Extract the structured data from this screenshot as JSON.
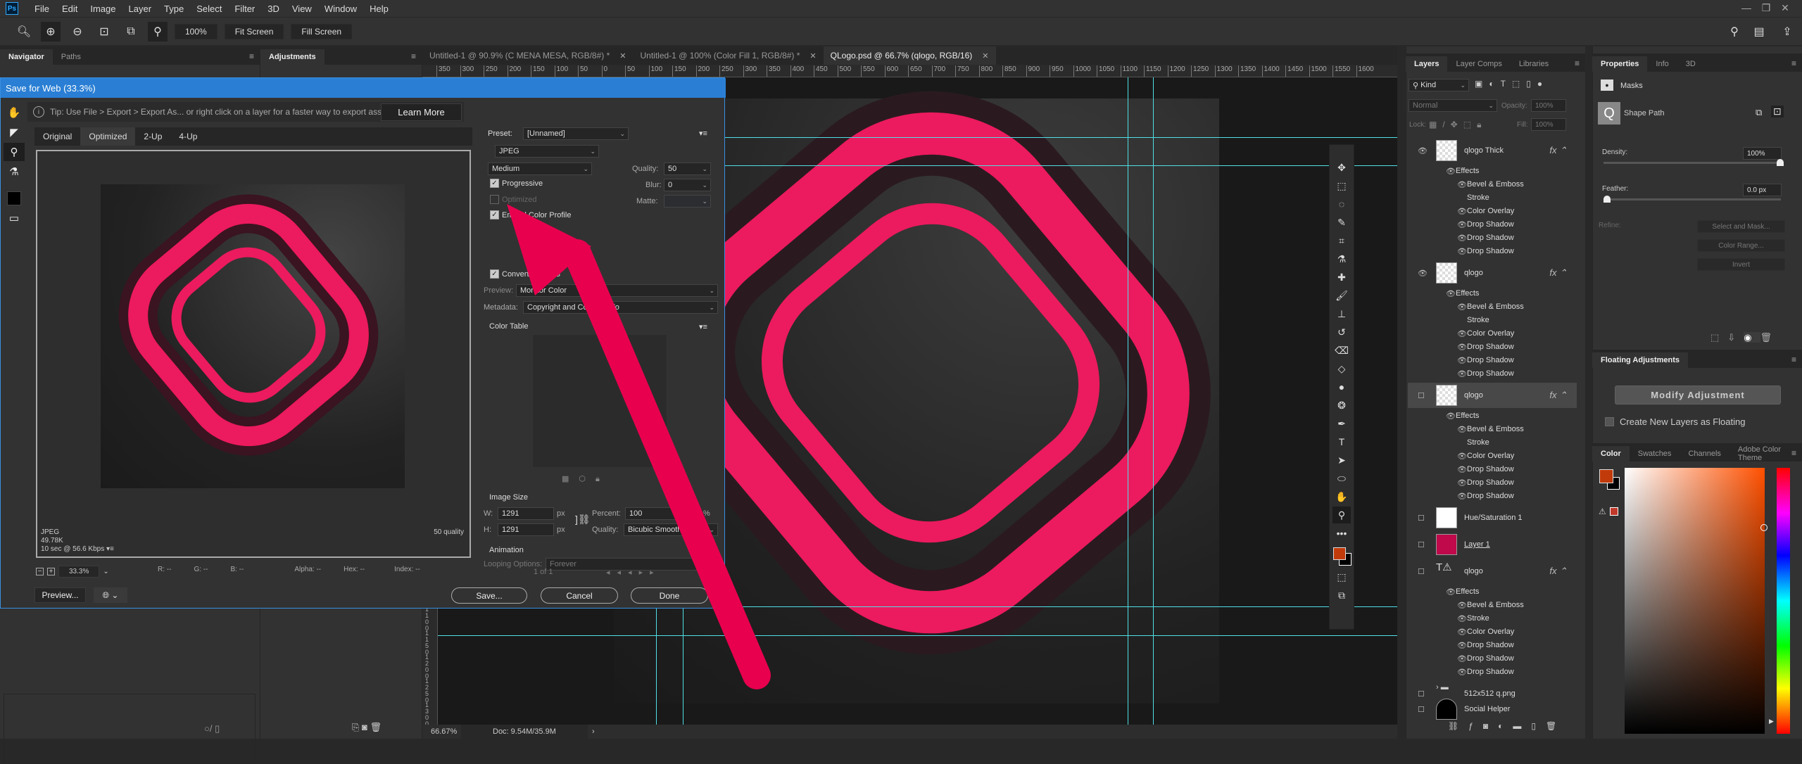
{
  "app": {
    "logo": "Ps"
  },
  "menu": [
    "File",
    "Edit",
    "Image",
    "Layer",
    "Type",
    "Select",
    "Filter",
    "3D",
    "View",
    "Window",
    "Help"
  ],
  "window_controls": {
    "minimize": "—",
    "restore": "❐",
    "close": "✕"
  },
  "options_bar": {
    "zoom_value": "100%",
    "fit_screen": "Fit Screen",
    "fill_screen": "Fill Screen"
  },
  "left_panels": {
    "navigator_tabs": [
      "Navigator",
      "Paths"
    ],
    "adjustments_tab": "Adjustments"
  },
  "doc_tabs": [
    {
      "label": "Untitled-1 @ 90.9% (C MENA MESA, RGB/8#) *",
      "active": false
    },
    {
      "label": "Untitled-1 @ 100% (Color Fill 1, RGB/8#) *",
      "active": false
    },
    {
      "label": "QLogo.psd @ 66.7% (qlogo, RGB/16)",
      "active": true
    }
  ],
  "ruler": {
    "h_ticks": [
      "350",
      "300",
      "250",
      "200",
      "150",
      "100",
      "50",
      "0",
      "50",
      "100",
      "150",
      "200",
      "250",
      "300",
      "350",
      "400",
      "450",
      "500",
      "550",
      "600",
      "650",
      "700",
      "750",
      "800",
      "850",
      "900",
      "950",
      "1000",
      "1050",
      "1100",
      "1150",
      "1200",
      "1250",
      "1300",
      "1350",
      "1400",
      "1450",
      "1500",
      "1550",
      "1600"
    ],
    "v_ticks": [
      "1100",
      "1150",
      "1200",
      "1250",
      "1300"
    ]
  },
  "status": {
    "zoom": "66.67%",
    "doc": "Doc: 9.54M/35.9M"
  },
  "dialog": {
    "title": "Save for Web (33.3%)",
    "tip": "Tip: Use File > Export > Export As...  or right click on a layer for a faster way to export assets",
    "learn_more": "Learn More",
    "view_tabs": [
      "Original",
      "Optimized",
      "2-Up",
      "4-Up"
    ],
    "active_view": "Optimized",
    "preview_info": {
      "format": "JPEG",
      "size": "49.78K",
      "time": "10 sec @ 56.6 Kbps",
      "quality": "50 quality"
    },
    "zoom": "33.3%",
    "readout": {
      "r": "R: --",
      "g": "G: --",
      "b": "B: --",
      "alpha": "Alpha: --",
      "hex": "Hex: --",
      "index": "Index: --"
    },
    "preview_button": "Preview...",
    "settings": {
      "preset_label": "Preset:",
      "preset": "[Unnamed]",
      "format": "JPEG",
      "compression": "Medium",
      "quality_label": "Quality:",
      "quality": "50",
      "blur_label": "Blur:",
      "blur": "0",
      "matte_label": "Matte:",
      "progressive": {
        "label": "Progressive",
        "checked": true
      },
      "optimized": {
        "label": "Optimized",
        "checked": false
      },
      "embed": {
        "label": "Embed Color Profile",
        "checked": true
      },
      "convert": {
        "label": "Convert to sRGB",
        "checked": true
      },
      "preview_label": "Preview:",
      "preview_value": "Monitor Color",
      "metadata_label": "Metadata:",
      "metadata_value": "Copyright and Contact Info",
      "color_table": "Color Table",
      "image_size": "Image Size",
      "w_label": "W:",
      "w": "1291",
      "h_label": "H:",
      "h": "1291",
      "px": "px",
      "percent_label": "Percent:",
      "percent": "100",
      "pct": "%",
      "resample_label": "Quality:",
      "resample": "Bicubic Smoother",
      "animation": "Animation",
      "looping_label": "Looping Options:",
      "looping": "Forever",
      "frame": "1 of 1"
    },
    "buttons": {
      "save": "Save...",
      "cancel": "Cancel",
      "done": "Done"
    }
  },
  "layers_panel": {
    "tabs": [
      "Layers",
      "Layer Comps",
      "Libraries"
    ],
    "filter": "Kind",
    "blend": "Normal",
    "opacity_label": "Opacity:",
    "opacity": "100%",
    "lock_label": "Lock:",
    "fill_label": "Fill:",
    "fill": "100%",
    "effects_label": "Effects",
    "layers": [
      {
        "name": "qlogo Thick",
        "fx": true,
        "effects": [
          "Bevel & Emboss",
          "Stroke",
          "Color Overlay",
          "Drop Shadow",
          "Drop Shadow",
          "Drop Shadow"
        ]
      },
      {
        "name": "qlogo",
        "fx": true,
        "effects": [
          "Bevel & Emboss",
          "Stroke",
          "Color Overlay",
          "Drop Shadow",
          "Drop Shadow",
          "Drop Shadow"
        ]
      },
      {
        "name": "qlogo",
        "fx": true,
        "selected": true,
        "effects": [
          "Bevel & Emboss",
          "Stroke",
          "Color Overlay",
          "Drop Shadow",
          "Drop Shadow",
          "Drop Shadow"
        ]
      },
      {
        "name": "Hue/Saturation 1"
      },
      {
        "name": "Layer 1"
      },
      {
        "name": "qlogo",
        "fx": true,
        "type": "text",
        "effects": [
          "Bevel & Emboss",
          "Stroke",
          "Color Overlay",
          "Drop Shadow",
          "Drop Shadow",
          "Drop Shadow"
        ]
      },
      {
        "name": "512x512 q.png",
        "type": "group"
      },
      {
        "name": "Social Helper"
      }
    ]
  },
  "properties_panel": {
    "tabs": [
      "Properties",
      "Info",
      "3D"
    ],
    "section": "Masks",
    "shape": "Shape Path",
    "density_label": "Density:",
    "density": "100%",
    "density_value": 1.0,
    "feather_label": "Feather:",
    "feather": "0.0 px",
    "feather_value": 0.0,
    "refine_label": "Refine:",
    "select_mask": "Select and Mask...",
    "color_range": "Color Range...",
    "invert": "Invert"
  },
  "floating_panel": {
    "title": "Floating Adjustments",
    "modify": "Modify Adjustment",
    "create_label": "Create New Layers as Floating"
  },
  "color_panel": {
    "tabs": [
      "Color",
      "Swatches",
      "Channels",
      "Adobe Color Theme"
    ],
    "foreground": "#c03a0a",
    "background": "#000000",
    "warning_swatch": "#c0392b"
  },
  "colors": {
    "accent_pink": "#ec1a5e",
    "guide": "#4fe0e6",
    "dialog_blue": "#2a7fd4"
  }
}
